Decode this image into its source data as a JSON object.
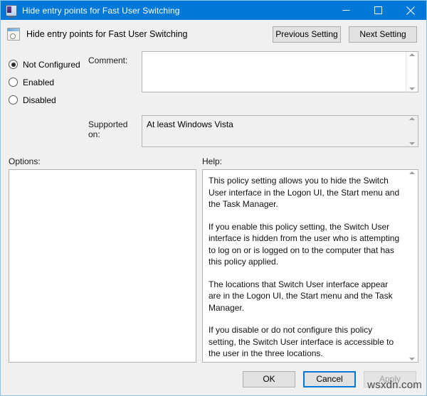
{
  "window": {
    "title": "Hide entry points for Fast User Switching",
    "titlebar_icon": "policy-monitor-icon",
    "accent_color": "#0078D7",
    "border_color": "#8EC3E8",
    "minimize_label": "Minimize",
    "maximize_label": "Maximize",
    "close_label": "Close"
  },
  "header": {
    "icon": "group-policy-setting-icon",
    "title": "Hide entry points for Fast User Switching",
    "previous_setting_label": "Previous Setting",
    "next_setting_label": "Next Setting"
  },
  "state_options": {
    "items": [
      {
        "label": "Not Configured",
        "selected": true
      },
      {
        "label": "Enabled",
        "selected": false
      },
      {
        "label": "Disabled",
        "selected": false
      }
    ]
  },
  "comment": {
    "label": "Comment:",
    "value": "",
    "placeholder": ""
  },
  "supported_on": {
    "label": "Supported on:",
    "value": "At least Windows Vista"
  },
  "options": {
    "label": "Options:",
    "content": ""
  },
  "help": {
    "label": "Help:",
    "paragraphs": [
      "This policy setting allows you to hide the Switch User interface in the Logon UI, the Start menu and the Task Manager.",
      "If you enable this policy setting, the Switch User interface is hidden from the user who is attempting to log on or is logged on to the computer that has this policy applied.",
      "The locations that Switch User interface appear are in the Logon UI, the Start menu and the Task Manager.",
      "If you disable or do not configure this policy setting, the Switch User interface is accessible to the user in the three locations."
    ]
  },
  "footer": {
    "ok_label": "OK",
    "cancel_label": "Cancel",
    "apply_label": "Apply",
    "apply_disabled": true,
    "cancel_focused": true
  },
  "watermark": {
    "text": "wsxdn.com"
  }
}
